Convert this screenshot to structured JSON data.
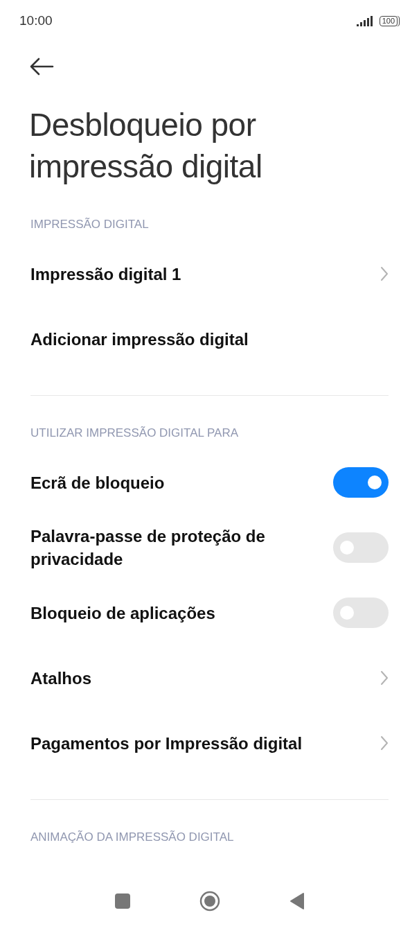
{
  "status_bar": {
    "time": "10:00",
    "battery": "100"
  },
  "title": "Desbloqueio por impressão digital",
  "sections": [
    {
      "header": "IMPRESSÃO DIGITAL",
      "items": [
        {
          "kind": "chevron",
          "label": "Impressão digital 1"
        },
        {
          "kind": "plain",
          "label": "Adicionar impressão digital"
        }
      ]
    },
    {
      "header": "UTILIZAR IMPRESSÃO DIGITAL PARA",
      "items": [
        {
          "kind": "toggle",
          "label": "Ecrã de bloqueio",
          "on": true
        },
        {
          "kind": "toggle",
          "label": "Palavra-passe de proteção de privacidade",
          "on": false
        },
        {
          "kind": "toggle",
          "label": "Bloqueio de aplicações",
          "on": false
        },
        {
          "kind": "chevron",
          "label": "Atalhos"
        },
        {
          "kind": "chevron",
          "label": "Pagamentos por Impressão digital"
        }
      ]
    },
    {
      "header": "ANIMAÇÃO DA IMPRESSÃO DIGITAL"
    }
  ]
}
